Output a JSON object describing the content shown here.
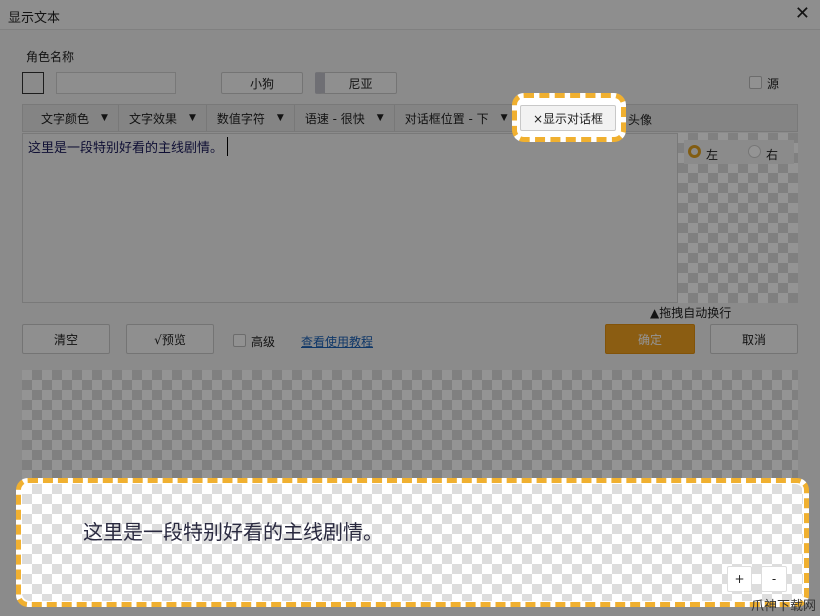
{
  "window": {
    "title": "显示文本",
    "close_icon": "close-icon"
  },
  "character": {
    "label": "角色名称",
    "name_value": "",
    "presets": [
      "小狗",
      "尼亚"
    ],
    "source_label": "源"
  },
  "toolbar": {
    "items": [
      {
        "label": "文字颜色",
        "dropdown": true
      },
      {
        "label": "文字效果",
        "dropdown": true
      },
      {
        "label": "数值字符",
        "dropdown": true
      },
      {
        "label": "语速 - 很快",
        "dropdown": true
      },
      {
        "label": "对话框位置 - 下",
        "dropdown": true
      }
    ],
    "show_dialog_label": "×显示对话框",
    "avatar_label": "头像"
  },
  "editor": {
    "text": "这里是一段特别好看的主线剧情。"
  },
  "avatar_side": {
    "left": "左",
    "right": "右",
    "selected": "左"
  },
  "drag_hint": "▲拖拽自动换行",
  "actions": {
    "clear": "清空",
    "preview": "√预览",
    "advanced": "高级",
    "tutorial_link": "查看使用教程",
    "confirm": "确定",
    "cancel": "取消"
  },
  "preview": {
    "text": "这里是一段特别好看的主线剧情。",
    "zoom_in": "+",
    "zoom_out": "-"
  },
  "colors": {
    "accent": "#f0a020",
    "highlight_dash": "#f0b030",
    "text": "#1a1a5a",
    "link": "#1a5fb4"
  },
  "watermark": "爪神下载网"
}
